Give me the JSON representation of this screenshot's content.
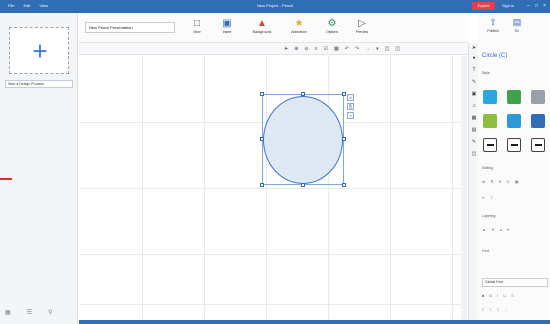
{
  "titlebar": {
    "menus": [
      "File",
      "Edit",
      "View"
    ],
    "title": "New Project - Pencil",
    "status_badge": "Expired",
    "right_text": "Sign in",
    "minimize": "–",
    "maximize": "□",
    "close": "×"
  },
  "colors": {
    "accent": "#2f6db5",
    "badge": "#e0443c",
    "shape_fill": "#dfe9f6",
    "shape_stroke": "#4274c6"
  },
  "left_panel": {
    "add_icon": "+",
    "page_name": "Start a Design Process"
  },
  "toolbar": {
    "doc_name": "New Pencil Presentation",
    "tools": [
      {
        "label": "New",
        "icon": "page-icon"
      },
      {
        "label": "Insert",
        "icon": "insert-icon"
      },
      {
        "label": "Background",
        "icon": "background-icon"
      },
      {
        "label": "Animation",
        "icon": "animation-icon"
      },
      {
        "label": "Options",
        "icon": "options-icon"
      },
      {
        "label": "Preview",
        "icon": "preview-icon"
      }
    ]
  },
  "right_panel": {
    "publish_label": "Publish",
    "save_label": "Ex",
    "title": "Circle (C)",
    "style_label": "Style",
    "editing_label": "Editing",
    "text_style_label": "T",
    "layering_label": "Layering",
    "font_label": "Font",
    "font_value": "Global Font",
    "swatches": [
      "#29a8e0",
      "#3fa34d",
      "#9aa0a6",
      "#8cbf3f",
      "#2d9ad8",
      "#2f6db5"
    ]
  }
}
